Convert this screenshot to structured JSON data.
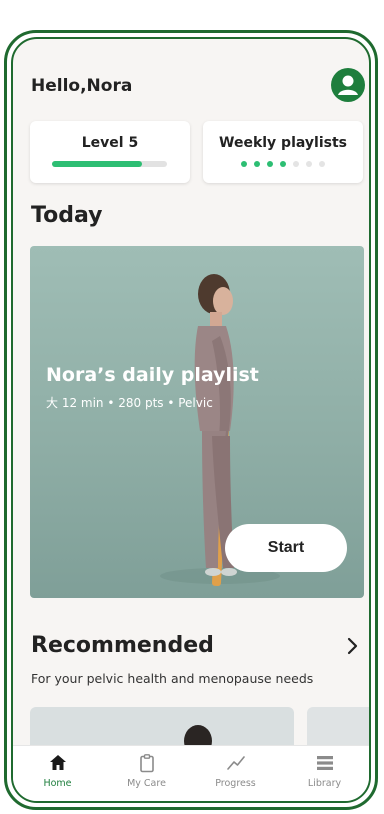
{
  "header": {
    "greeting": "Hello,Nora",
    "avatar_icon": "user-icon"
  },
  "level_card": {
    "label": "Level 5",
    "progress": 0.78
  },
  "weekly_card": {
    "label": "Weekly playlists",
    "completed": 4,
    "total": 7
  },
  "today": {
    "heading": "Today",
    "hero": {
      "title": "Nora’s daily playlist",
      "meta": "大 12 min • 280 pts • Pelvic",
      "start_label": "Start"
    }
  },
  "recommended": {
    "heading": "Recommended",
    "subtitle": "For your pelvic health and menopause needs"
  },
  "tabs": [
    {
      "label": "Home",
      "icon": "home-icon",
      "active": true
    },
    {
      "label": "My Care",
      "icon": "clipboard-icon",
      "active": false
    },
    {
      "label": "Progress",
      "icon": "trend-icon",
      "active": false
    },
    {
      "label": "Library",
      "icon": "list-icon",
      "active": false
    }
  ],
  "colors": {
    "brand_green": "#1e7e3d",
    "progress_green": "#2dbe73",
    "frame": "#1f6a2f",
    "hero_bg": "#9fbdb5"
  }
}
